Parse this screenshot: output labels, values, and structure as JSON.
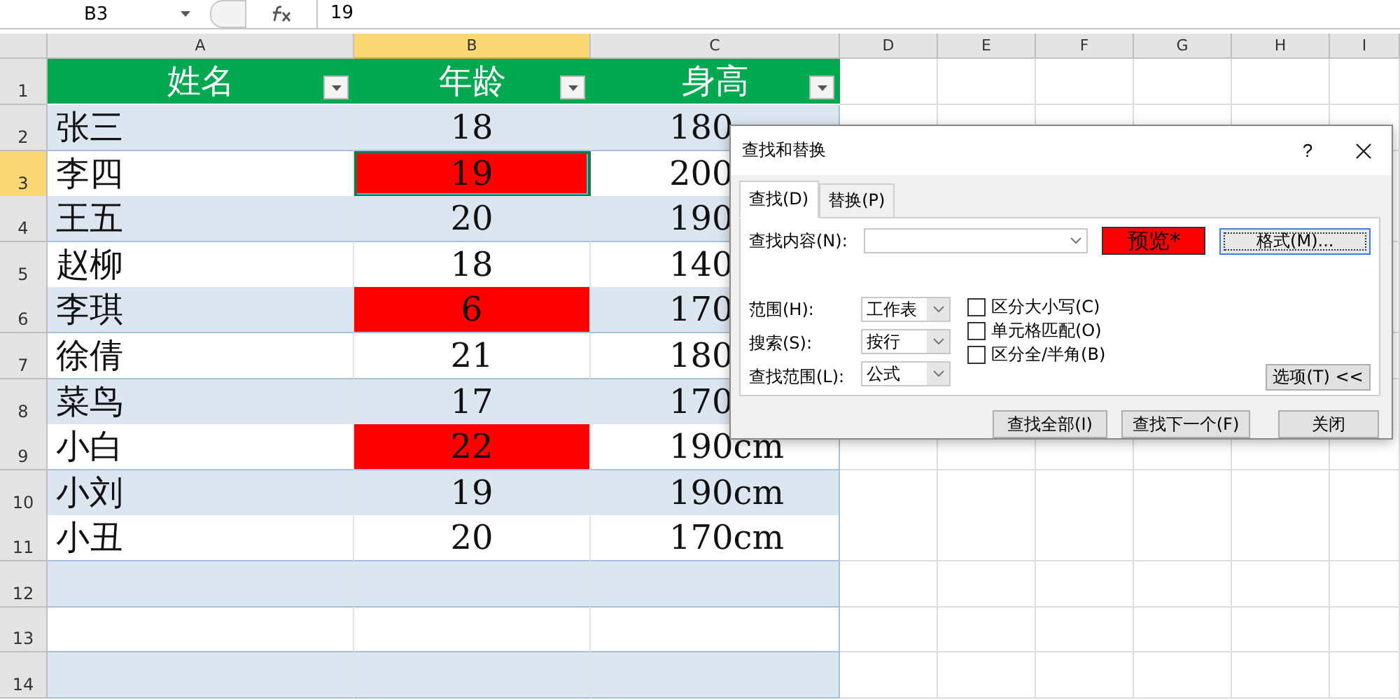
{
  "formula_bar": {
    "name_box": "B3",
    "formula": "19"
  },
  "columns": [
    {
      "label": "A",
      "selected": false
    },
    {
      "label": "B",
      "selected": true
    },
    {
      "label": "C",
      "selected": false
    },
    {
      "label": "D",
      "selected": false
    },
    {
      "label": "E",
      "selected": false
    },
    {
      "label": "F",
      "selected": false
    },
    {
      "label": "G",
      "selected": false
    },
    {
      "label": "H",
      "selected": false
    },
    {
      "label": "I",
      "selected": false
    }
  ],
  "table": {
    "header": [
      "姓名",
      "年龄",
      "身高"
    ],
    "rows": [
      {
        "number": "2",
        "selected": false,
        "cells": [
          {
            "text": "张三",
            "highlighted": false,
            "selected": false
          },
          {
            "text": "18",
            "highlighted": false,
            "selected": false
          },
          {
            "text": "180",
            "highlighted": false,
            "selected": false
          }
        ]
      },
      {
        "number": "3",
        "selected": true,
        "cells": [
          {
            "text": "李四",
            "highlighted": false,
            "selected": false
          },
          {
            "text": "19",
            "highlighted": true,
            "selected": true
          },
          {
            "text": "200",
            "highlighted": false,
            "selected": false
          }
        ]
      },
      {
        "number": "4",
        "selected": false,
        "cells": [
          {
            "text": "王五",
            "highlighted": false,
            "selected": false
          },
          {
            "text": "20",
            "highlighted": false,
            "selected": false
          },
          {
            "text": "190",
            "highlighted": false,
            "selected": false
          }
        ]
      },
      {
        "number": "5",
        "selected": false,
        "cells": [
          {
            "text": "赵柳",
            "highlighted": false,
            "selected": false
          },
          {
            "text": "18",
            "highlighted": false,
            "selected": false
          },
          {
            "text": "140",
            "highlighted": false,
            "selected": false
          }
        ]
      },
      {
        "number": "6",
        "selected": false,
        "cells": [
          {
            "text": "李琪",
            "highlighted": false,
            "selected": false
          },
          {
            "text": "6",
            "highlighted": true,
            "selected": false
          },
          {
            "text": "170",
            "highlighted": false,
            "selected": false
          }
        ]
      },
      {
        "number": "7",
        "selected": false,
        "cells": [
          {
            "text": "徐倩",
            "highlighted": false,
            "selected": false
          },
          {
            "text": "21",
            "highlighted": false,
            "selected": false
          },
          {
            "text": "180",
            "highlighted": false,
            "selected": false
          }
        ]
      },
      {
        "number": "8",
        "selected": false,
        "cells": [
          {
            "text": "菜鸟",
            "highlighted": false,
            "selected": false
          },
          {
            "text": "17",
            "highlighted": false,
            "selected": false
          },
          {
            "text": "170",
            "highlighted": false,
            "selected": false
          }
        ]
      },
      {
        "number": "9",
        "selected": false,
        "cells": [
          {
            "text": "小白",
            "highlighted": false,
            "selected": false
          },
          {
            "text": "22",
            "highlighted": true,
            "selected": false
          },
          {
            "text": "190cm",
            "highlighted": false,
            "selected": false
          }
        ]
      },
      {
        "number": "10",
        "selected": false,
        "cells": [
          {
            "text": "小刘",
            "highlighted": false,
            "selected": false
          },
          {
            "text": "19",
            "highlighted": false,
            "selected": false
          },
          {
            "text": "190cm",
            "highlighted": false,
            "selected": false
          }
        ]
      },
      {
        "number": "11",
        "selected": false,
        "cells": [
          {
            "text": "小丑",
            "highlighted": false,
            "selected": false
          },
          {
            "text": "20",
            "highlighted": false,
            "selected": false
          },
          {
            "text": "170cm",
            "highlighted": false,
            "selected": false
          }
        ]
      },
      {
        "number": "12",
        "selected": false,
        "cells": []
      },
      {
        "number": "13",
        "selected": false,
        "cells": []
      },
      {
        "number": "14",
        "selected": false,
        "cells": []
      }
    ]
  },
  "header_row_number": "1",
  "dialog": {
    "title": "查找和替换",
    "help": "?",
    "tabs": [
      {
        "label": "查找(D)",
        "selected": true
      },
      {
        "label": "替换(P)",
        "selected": false
      }
    ],
    "find_label": "查找内容(N):",
    "preview": "预览*",
    "format_button": "格式(M)...",
    "options": [
      {
        "label": "范围(H):",
        "value": "工作表"
      },
      {
        "label": "搜索(S):",
        "value": "按行"
      },
      {
        "label": "查找范围(L):",
        "value": "公式"
      }
    ],
    "checkboxes": [
      {
        "label": "区分大小写(C)",
        "checked": false
      },
      {
        "label": "单元格匹配(O)",
        "checked": false
      },
      {
        "label": "区分全/半角(B)",
        "checked": false
      }
    ],
    "options_button": "选项(T) <<",
    "buttons": [
      "查找全部(I)",
      "查找下一个(F)",
      "关闭"
    ]
  }
}
